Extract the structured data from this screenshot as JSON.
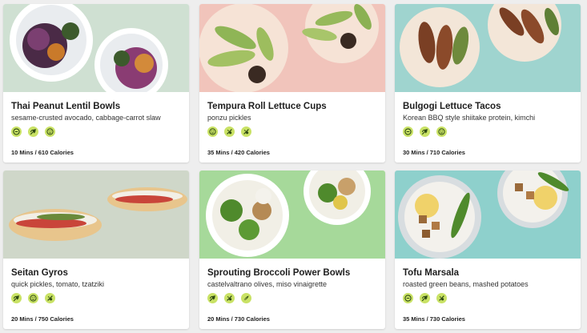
{
  "colors": {
    "icon_bg": "#c9e265",
    "icon_fg": "#2f4a14",
    "page_bg": "#eeeeee"
  },
  "recipes": [
    {
      "title": "Thai Peanut Lentil Bowls",
      "subtitle": "sesame-crusted avocado, cabbage-carrot slaw",
      "meta": "10 Mins / 610 Calories",
      "icons": [
        "gluten-free-icon",
        "vegan-icon",
        "dairy-free-icon"
      ],
      "photo_bg": "#cfe0d2"
    },
    {
      "title": "Tempura Roll Lettuce Cups",
      "subtitle": "ponzu pickles",
      "meta": "35 Mins / 420 Calories",
      "icons": [
        "dairy-free-icon",
        "nut-free-icon",
        "soy-free-icon"
      ],
      "photo_bg": "#f1c4bb"
    },
    {
      "title": "Bulgogi Lettuce Tacos",
      "subtitle": "Korean BBQ style shiitake protein, kimchi",
      "meta": "30 Mins / 710 Calories",
      "icons": [
        "gluten-free-icon",
        "vegan-icon",
        "dairy-free-icon"
      ],
      "photo_bg": "#9fd4cf"
    },
    {
      "title": "Seitan Gyros",
      "subtitle": "quick pickles, tomato, tzatziki",
      "meta": "20 Mins / 750 Calories",
      "icons": [
        "vegan-icon",
        "dairy-free-icon",
        "soy-free-icon"
      ],
      "photo_bg": "#cfd7c9"
    },
    {
      "title": "Sprouting Broccoli Power Bowls",
      "subtitle": "castelvaltrano olives, miso vinaigrette",
      "meta": "20 Mins / 730 Calories",
      "icons": [
        "vegan-icon",
        "soy-free-icon",
        "low-cal-icon"
      ],
      "photo_bg": "#a6d99a"
    },
    {
      "title": "Tofu Marsala",
      "subtitle": "roasted green beans, mashed potatoes",
      "meta": "35 Mins / 730 Calories",
      "icons": [
        "gluten-free-icon",
        "vegan-icon",
        "soy-free-icon"
      ],
      "photo_bg": "#8ed0cc"
    }
  ]
}
